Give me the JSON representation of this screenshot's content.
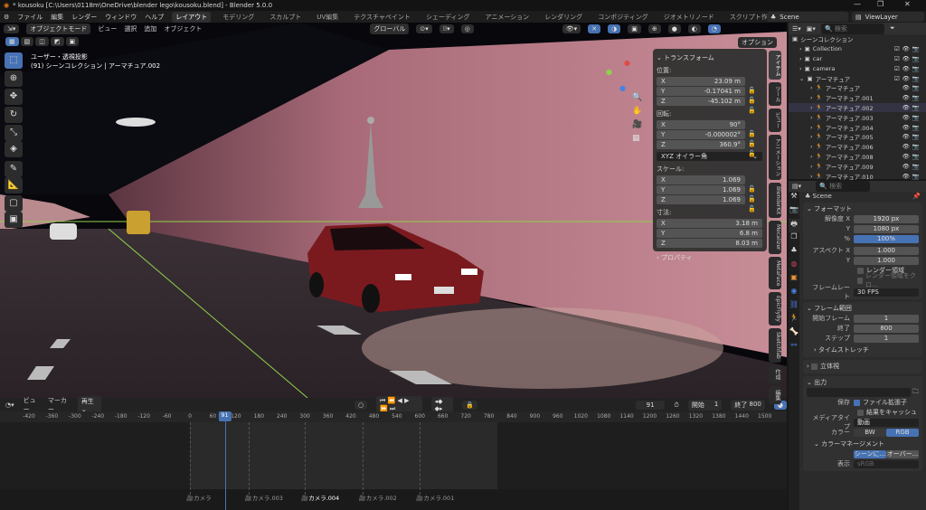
{
  "title": "* kousoku [C:\\Users\\0118m\\OneDrive\\blender lego\\kousoku.blend] - Blender 5.0.0",
  "window_controls": [
    "—",
    "❐",
    "✕"
  ],
  "menu": [
    "ファイル",
    "編集",
    "レンダー",
    "ウィンドウ",
    "ヘルプ"
  ],
  "workspaces": [
    "レイアウト",
    "モデリング",
    "スカルプト",
    "UV編集",
    "テクスチャペイント",
    "シェーディング",
    "アニメーション",
    "レンダリング",
    "コンポジティング",
    "ジオメトリノード",
    "スクリプト作成",
    "+"
  ],
  "scene": "Scene",
  "view_layer": "ViewLayer",
  "viewport": {
    "mode": "オブジェクトモード",
    "menus": [
      "ビュー",
      "選択",
      "追加",
      "オブジェクト"
    ],
    "orientation": "グローバル",
    "options": "オプション",
    "overlay_line1": "ユーザー・透視投影",
    "overlay_line2": "(91) シーンコレクション | アーマチュア.002"
  },
  "npanel": {
    "transform": "トランスフォーム",
    "location": "位置:",
    "loc": [
      "23.09 m",
      "-0.17041 m",
      "-45.102 m"
    ],
    "rotation": "回転:",
    "rot": [
      "90°",
      "-0.000002°",
      "360.9°"
    ],
    "rot_mode": "XYZ オイラー角",
    "scale": "スケール:",
    "scl": [
      "1.069",
      "1.069",
      "1.069"
    ],
    "dimensions": "寸法:",
    "dim": [
      "3.18 m",
      "6.8 m",
      "8.03 m"
    ],
    "axes": [
      "X",
      "Y",
      "Z"
    ],
    "properties": "プロパティ",
    "tabs": [
      "アイテム",
      "ツール",
      "ビュー",
      "アニメーション",
      "BlenderKit",
      "Mecalizer",
      "MetaFace",
      "EpicFlyBy",
      "Sketchfab",
      "作成",
      "編集"
    ]
  },
  "outliner": {
    "search_placeholder": "検索",
    "root": "シーンコレクション",
    "collections": [
      "Collection",
      "car",
      "camera",
      "アーマチュア"
    ],
    "armatures": [
      "アーマチュア",
      "アーマチュア.001",
      "アーマチュア.002",
      "アーマチュア.003",
      "アーマチュア.004",
      "アーマチュア.005",
      "アーマチュア.006",
      "アーマチュア.008",
      "アーマチュア.009",
      "アーマチュア.010"
    ]
  },
  "properties": {
    "search_placeholder": "検索",
    "scene": "Scene",
    "format": "フォーマット",
    "res_x_label": "解像度 X",
    "res_x": "1920 px",
    "y_label": "Y",
    "res_y": "1080 px",
    "pct_label": "%",
    "pct": "100%",
    "aspect_label": "アスペクト X",
    "aspect_x": "1.000",
    "aspect_y": "1.000",
    "render_region": "レンダー領域",
    "crop": "レンダー領域をクロ...",
    "fps_label": "フレームレート",
    "fps": "30 FPS",
    "frame_range": "フレーム範囲",
    "start_label": "開始フレーム",
    "start": "1",
    "end_label": "終了",
    "end": "800",
    "step_label": "ステップ",
    "step": "1",
    "time_stretch": "タイムストレッチ",
    "stereo": "立体視",
    "output": "出力",
    "save_label": "保存",
    "file_ext": "ファイル拡張子",
    "cache": "結果をキャッシュ",
    "media_label": "メディアタイプ",
    "media": "動画",
    "color_label": "カラー",
    "bw": "BW",
    "rgb": "RGB",
    "color_mgmt": "カラーマネージメント",
    "scene_btn": "シーンに...",
    "override_btn": "オーバー...",
    "display_label": "表示",
    "display": "sRGB"
  },
  "timeline": {
    "menus": [
      "ビュー",
      "マーカー",
      "再生"
    ],
    "current_frame": "91",
    "start_label": "開始",
    "start": "1",
    "end_label": "終了",
    "end": "800",
    "ticks": [
      -420,
      -360,
      -300,
      -240,
      -180,
      -120,
      -60,
      0,
      60,
      120,
      180,
      240,
      300,
      360,
      420,
      480,
      540,
      600,
      660,
      720,
      780,
      840,
      900,
      960,
      1020,
      1080,
      1140,
      1200,
      1260,
      1320,
      1380,
      1440,
      1500
    ],
    "markers": [
      {
        "name": "カメラ",
        "frame": 0
      },
      {
        "name": "カメラ.003",
        "frame": 153
      },
      {
        "name": "カメラ.004",
        "frame": 300,
        "selected": true
      },
      {
        "name": "カメラ.002",
        "frame": 450
      },
      {
        "name": "カメラ.001",
        "frame": 600
      }
    ]
  },
  "colors": {
    "accent": "#4772b3",
    "object": "#e8963b",
    "wall": "#b97a84"
  }
}
